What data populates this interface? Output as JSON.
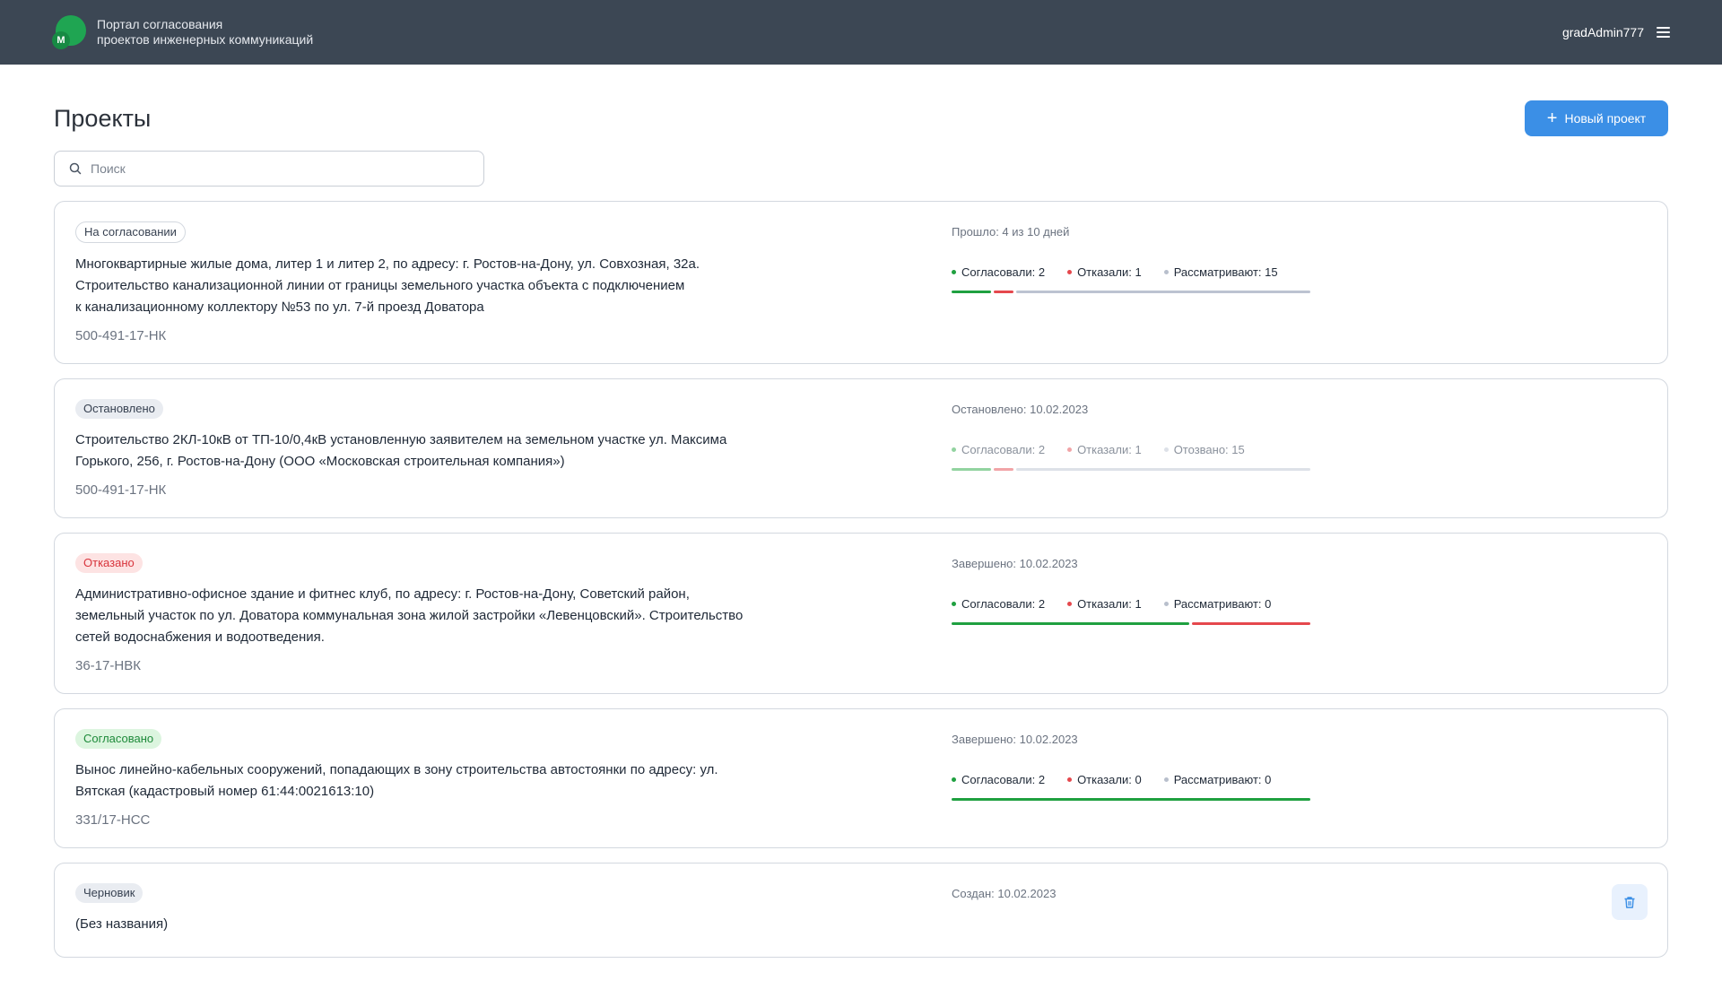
{
  "header": {
    "title_line1": "Портал согласования",
    "title_line2": "проектов инженерных коммуникаций",
    "logo_letter": "М",
    "username": "gradAdmin777"
  },
  "page": {
    "title": "Проекты",
    "new_project_label": "Новый проект",
    "search_placeholder": "Поиск"
  },
  "colors": {
    "header_bg": "#3c4754",
    "accent": "#3b8fe6",
    "approved": "#1fa040",
    "rejected": "#e5484d",
    "pending": "#bcc3d1"
  },
  "projects": [
    {
      "status": "На согласовании",
      "description_lines": [
        "Многоквартирные жилые дома, литер 1 и литер 2, по адресу: г. Ростов-на-Дону, ул. Совхозная, 32а.",
        "Строительство канализационной линии от границы земельного участка объекта с подключением",
        "к канализационному коллектору №53 по ул. 7-й проезд Доватора"
      ],
      "code": "500-491-17-НК",
      "meta": "Прошло: 4 из 10 дней",
      "approved_label": "Согласовали: 2",
      "rejected_label": "Отказали: 1",
      "pending_label": "Рассматривают: 15",
      "approved": 2,
      "rejected": 1,
      "pending": 15
    },
    {
      "status": "Остановлено",
      "description_lines": [
        "Строительство 2КЛ-10кВ от ТП-10/0,4кВ установленную заявителем на земельном участке ул. Максима",
        "Горького, 256, г. Ростов-на-Дону (ООО «Московская строительная компания»)"
      ],
      "code": "500-491-17-НК",
      "meta": "Остановлено: 10.02.2023",
      "approved_label": "Согласовали: 2",
      "rejected_label": "Отказали: 1",
      "pending_label": "Отозвано: 15",
      "approved": 2,
      "rejected": 1,
      "pending": 15
    },
    {
      "status": "Отказано",
      "description_lines": [
        "Административно-офисное здание и фитнес клуб, по адресу: г. Ростов-на-Дону, Советский район,",
        "земельный участок по ул. Доватора коммунальная зона жилой застройки «Левенцовский». Строительство",
        "сетей водоснабжения и водоотведения."
      ],
      "code": "36-17-НВК",
      "meta": "Завершено: 10.02.2023",
      "approved_label": "Согласовали: 2",
      "rejected_label": "Отказали: 1",
      "pending_label": "Рассматривают: 0",
      "approved": 2,
      "rejected": 1,
      "pending": 0
    },
    {
      "status": "Согласовано",
      "description_lines": [
        "Вынос линейно-кабельных сооружений, попадающих в зону строительства автостоянки по адресу: ул.",
        "Вятская (кадастровый номер 61:44:0021613:10)"
      ],
      "code": "331/17-НСС",
      "meta": "Завершено: 10.02.2023",
      "approved_label": "Согласовали: 2",
      "rejected_label": "Отказали: 0",
      "pending_label": "Рассматривают: 0",
      "approved": 2,
      "rejected": 0,
      "pending": 0
    },
    {
      "status": "Черновик",
      "description_lines": [
        "(Без названия)"
      ],
      "meta": "Создан: 10.02.2023"
    }
  ]
}
